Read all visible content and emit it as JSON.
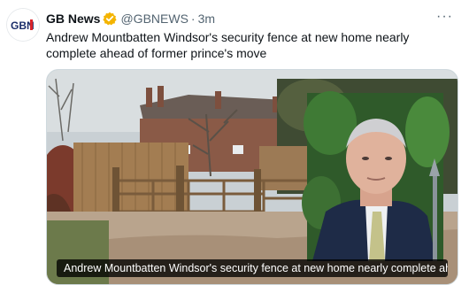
{
  "tweet": {
    "author_name": "GB News",
    "handle": "@GBNEWS",
    "separator": "·",
    "time": "3m",
    "more_label": "···",
    "text": "Andrew Mountbatten Windsor's security fence at new home nearly complete ahead of former prince's move",
    "media": {
      "caption": "Andrew Mountbatten Windsor's security fence at new home nearly complete ahe…"
    }
  },
  "avatar": {
    "logo_text": "GBN"
  },
  "colors": {
    "verified": "#f4b400",
    "brand_navy": "#1c2f6b",
    "brand_red": "#d8232a"
  }
}
